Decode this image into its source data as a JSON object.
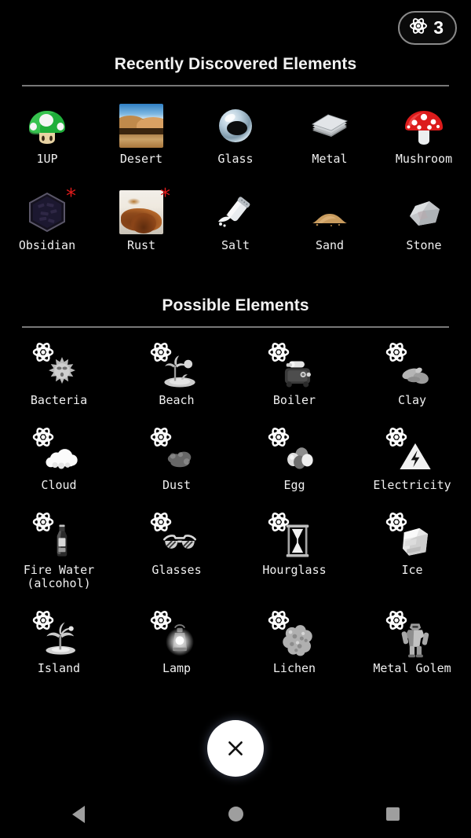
{
  "topbar": {
    "counter_value": "3",
    "counter_icon": "atom-icon"
  },
  "sections": {
    "discovered": {
      "title": "Recently Discovered Elements",
      "items": [
        {
          "label": "1UP",
          "icon": "mushroom-1up-icon",
          "is_new": false
        },
        {
          "label": "Desert",
          "icon": "desert-photo-icon",
          "is_new": false
        },
        {
          "label": "Glass",
          "icon": "glass-orb-icon",
          "is_new": false
        },
        {
          "label": "Metal",
          "icon": "metal-sheets-icon",
          "is_new": false
        },
        {
          "label": "Mushroom",
          "icon": "mushroom-icon",
          "is_new": false
        },
        {
          "label": "Obsidian",
          "icon": "obsidian-icon",
          "is_new": true
        },
        {
          "label": "Rust",
          "icon": "rust-photo-icon",
          "is_new": true
        },
        {
          "label": "Salt",
          "icon": "salt-shaker-icon",
          "is_new": false
        },
        {
          "label": "Sand",
          "icon": "sand-pile-icon",
          "is_new": false
        },
        {
          "label": "Stone",
          "icon": "stone-icon",
          "is_new": false
        }
      ]
    },
    "possible": {
      "title": "Possible Elements",
      "items": [
        {
          "label": "Bacteria",
          "icon": "bacteria-icon"
        },
        {
          "label": "Beach",
          "icon": "beach-icon"
        },
        {
          "label": "Boiler",
          "icon": "boiler-icon"
        },
        {
          "label": "Clay",
          "icon": "clay-icon"
        },
        {
          "label": "Cloud",
          "icon": "cloud-icon"
        },
        {
          "label": "Dust",
          "icon": "dust-icon"
        },
        {
          "label": "Egg",
          "icon": "egg-icon"
        },
        {
          "label": "Electricity",
          "icon": "electricity-icon"
        },
        {
          "label": "Fire Water\n(alcohol)",
          "icon": "bottle-icon"
        },
        {
          "label": "Glasses",
          "icon": "glasses-icon"
        },
        {
          "label": "Hourglass",
          "icon": "hourglass-icon"
        },
        {
          "label": "Ice",
          "icon": "ice-cube-icon"
        },
        {
          "label": "Island",
          "icon": "island-icon"
        },
        {
          "label": "Lamp",
          "icon": "lamp-icon"
        },
        {
          "label": "Lichen",
          "icon": "lichen-icon"
        },
        {
          "label": "Metal Golem",
          "icon": "metal-golem-icon"
        }
      ]
    }
  },
  "close_button": {
    "icon": "close-x-icon",
    "label": "×"
  },
  "navbar": {
    "back": "back-triangle-icon",
    "home": "home-circle-icon",
    "recents": "recents-square-icon"
  },
  "colors": {
    "background": "#000000",
    "text": "#f0f0f0",
    "divider": "#787878",
    "new_badge": "#e01b1b",
    "fab_background": "#ffffff",
    "nav_icon": "#9e9e9e"
  }
}
